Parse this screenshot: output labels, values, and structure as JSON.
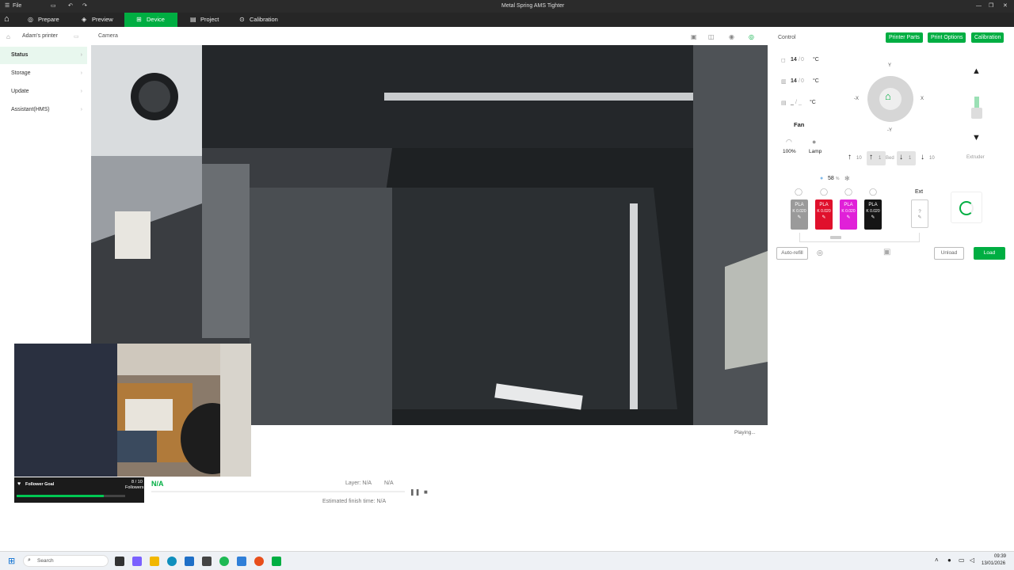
{
  "titlebar": {
    "menu_label": "File",
    "window_title": "Metal Spring AMS Tighter"
  },
  "nav": {
    "tabs": [
      {
        "label": "Prepare"
      },
      {
        "label": "Preview"
      },
      {
        "label": "Device"
      },
      {
        "label": "Project"
      },
      {
        "label": "Calibration"
      }
    ],
    "active_tab": "Device",
    "accent_color": "#00ae42"
  },
  "sidebar": {
    "printer_name": "Adam's printer",
    "items": [
      {
        "label": "Status"
      },
      {
        "label": "Storage"
      },
      {
        "label": "Update"
      },
      {
        "label": "Assistant(HMS)"
      }
    ]
  },
  "camera": {
    "label": "Camera",
    "playing_text": "Playing..."
  },
  "control": {
    "title": "Control",
    "buttons": {
      "printer_parts": "Printer Parts",
      "print_options": "Print Options",
      "calibration": "Calibration"
    },
    "temps": [
      {
        "current": "14",
        "sep": "/",
        "target": "0",
        "unit": "°C"
      },
      {
        "current": "14",
        "sep": "/",
        "target": "0",
        "unit": "°C"
      },
      {
        "current": "_",
        "sep": "/",
        "target": "_",
        "unit": "°C"
      }
    ],
    "fan_label": "Fan",
    "speed_value": "100%",
    "lamp_label": "Lamp",
    "axis": {
      "y": "Y",
      "neg_y": "-Y",
      "x": "X",
      "neg_x": "-X"
    },
    "bed": {
      "up10": "10",
      "up1": "1",
      "label": "Bed",
      "down1": "1",
      "down10": "10"
    },
    "extruder_label": "Extruder",
    "ams": {
      "humidity": "58",
      "humidity_unit": "%",
      "slots": [
        {
          "type": "PLA",
          "k": "K 0.020",
          "color": "#9a9a9a"
        },
        {
          "type": "PLA",
          "k": "K 0.020",
          "color": "#e0102c"
        },
        {
          "type": "PLA",
          "k": "K 0.020",
          "color": "#e020d8"
        },
        {
          "type": "PLA",
          "k": "K 0.020",
          "color": "#151515"
        }
      ],
      "ext_label": "Ext",
      "ext_slot_text": "?"
    },
    "auto_refill": "Auto-refill",
    "unload": "Unload",
    "load": "Load"
  },
  "status": {
    "progress_text": "N/A",
    "layer_label": "Layer: N/A",
    "layer_extra": "N/A",
    "finish_time": "Estimated finish time: N/A"
  },
  "overlay": {
    "goal_title": "Follower Goal",
    "goal_count": "8 / 10",
    "goal_unit": "Followers",
    "goal_progress": 0.8
  },
  "taskbar": {
    "search_placeholder": "Search",
    "time": "09:39",
    "date": "13/01/2026"
  }
}
